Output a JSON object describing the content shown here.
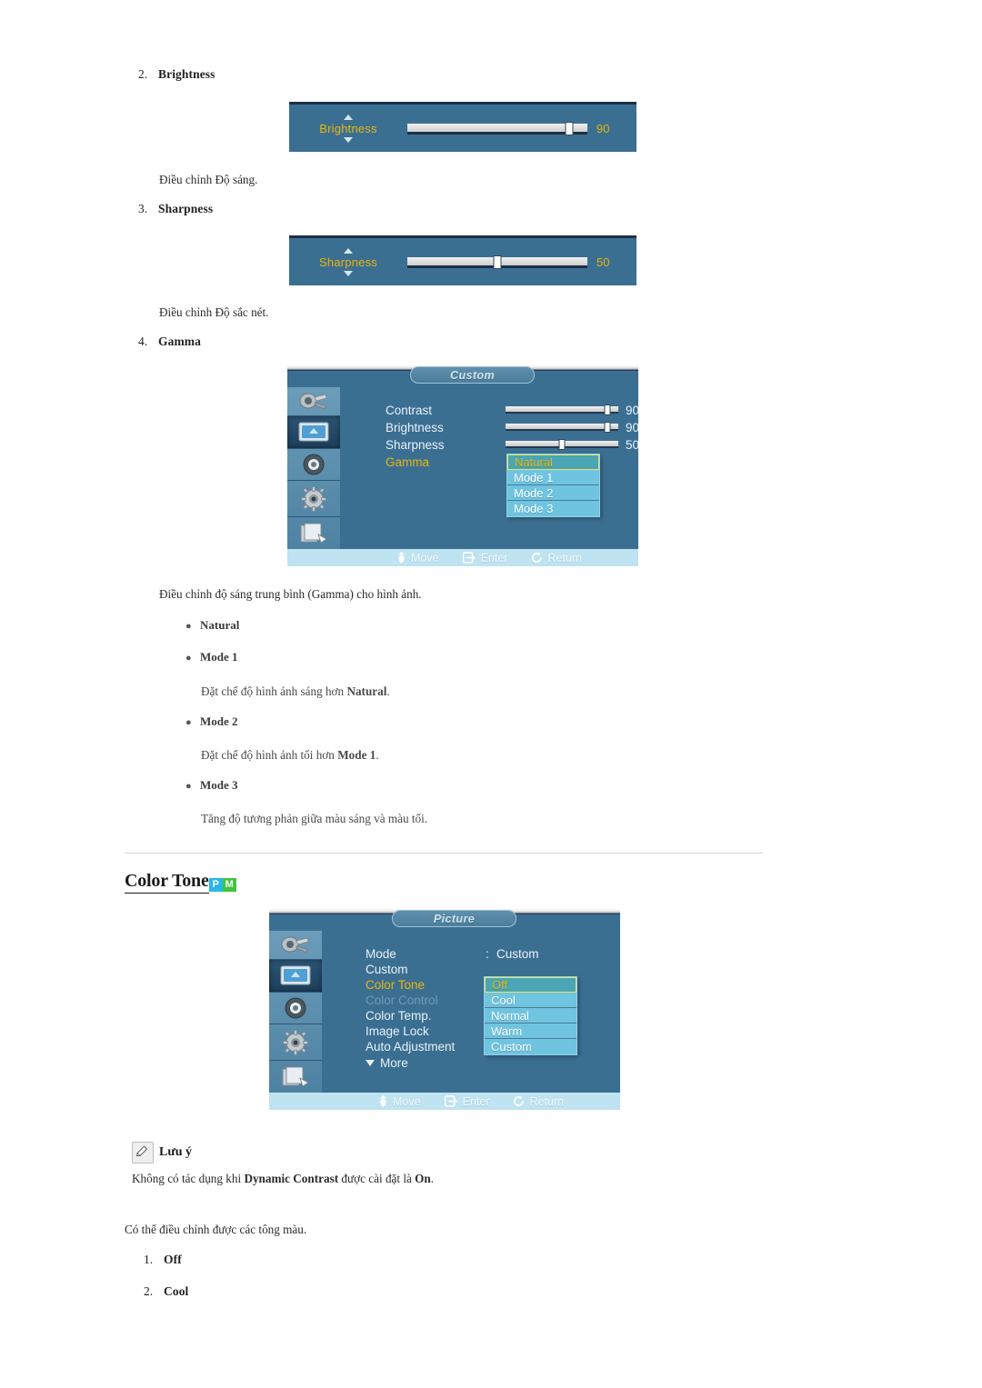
{
  "items": {
    "brightness": {
      "number": "2.",
      "label": "Brightness",
      "desc": "Điều chỉnh Độ sáng."
    },
    "sharpness": {
      "number": "3.",
      "label": "Sharpness",
      "desc": "Điều chỉnh Độ sắc nét."
    },
    "gamma": {
      "number": "4.",
      "label": "Gamma",
      "desc": "Điều chỉnh độ sáng trung bình (Gamma) cho hình ảnh."
    }
  },
  "brightness_widget": {
    "name": "Brightness",
    "value": "90",
    "percent": 90,
    "up_icon": "triangle-up-icon",
    "down_icon": "triangle-down-icon"
  },
  "sharpness_widget": {
    "name": "Sharpness",
    "value": "50",
    "percent": 50,
    "up_icon": "triangle-up-icon",
    "down_icon": "triangle-down-icon"
  },
  "custom_menu": {
    "title": "Custom",
    "sidebar": [
      {
        "icon": "input-source-icon",
        "selected": false
      },
      {
        "icon": "picture-icon",
        "selected": true
      },
      {
        "icon": "sound-speaker-icon",
        "selected": false
      },
      {
        "icon": "setup-gear-icon",
        "selected": false
      },
      {
        "icon": "multi-control-icon",
        "selected": false
      }
    ],
    "rows": [
      {
        "name": "Contrast",
        "value": "90",
        "percent": 90,
        "type": "slider",
        "state": "normal"
      },
      {
        "name": "Brightness",
        "value": "90",
        "percent": 90,
        "type": "slider",
        "state": "normal"
      },
      {
        "name": "Sharpness",
        "value": "50",
        "percent": 50,
        "type": "slider",
        "state": "normal"
      },
      {
        "name": "Gamma",
        "value": "",
        "type": "dropdown",
        "state": "active"
      }
    ],
    "dropdown": {
      "options": [
        "Natural",
        "Mode 1",
        "Mode 2",
        "Mode 3"
      ],
      "selected": "Natural"
    },
    "bottombar": [
      {
        "icon": "move-icon",
        "label": "Move"
      },
      {
        "icon": "enter-icon",
        "label": "Enter"
      },
      {
        "icon": "return-icon",
        "label": "Return"
      }
    ]
  },
  "gamma_modes": [
    {
      "label": "Natural",
      "desc": ""
    },
    {
      "label": "Mode 1",
      "desc": "Đặt chế độ hình ảnh sáng hơn ",
      "desc_bold": "Natural",
      "desc_tail": "."
    },
    {
      "label": "Mode 2",
      "desc": "Đặt chế độ hình ảnh tối hơn ",
      "desc_bold": "Mode 1",
      "desc_tail": "."
    },
    {
      "label": "Mode 3",
      "desc": "Tăng độ tương phản giữa màu sáng và màu tối.",
      "desc_bold": "",
      "desc_tail": ""
    }
  ],
  "color_tone_section": {
    "heading": "Color Tone",
    "badges": [
      {
        "letter": "P",
        "color": "#29b7e8"
      },
      {
        "letter": "M",
        "color": "#3fc63f"
      }
    ]
  },
  "picture_menu": {
    "title": "Picture",
    "sidebar": [
      {
        "icon": "input-source-icon",
        "selected": false
      },
      {
        "icon": "picture-icon",
        "selected": true
      },
      {
        "icon": "sound-speaker-icon",
        "selected": false
      },
      {
        "icon": "setup-gear-icon",
        "selected": false
      },
      {
        "icon": "multi-control-icon",
        "selected": false
      }
    ],
    "rows": [
      {
        "name": "Mode",
        "colon": ":",
        "value": "Custom",
        "state": "normal"
      },
      {
        "name": "Custom",
        "colon": "",
        "value": "",
        "state": "normal"
      },
      {
        "name": "Color Tone",
        "colon": ":",
        "value": "",
        "state": "active"
      },
      {
        "name": "Color Control",
        "colon": "",
        "value": "",
        "state": "disabled"
      },
      {
        "name": "Color Temp.",
        "colon": ":",
        "value": "",
        "state": "normal"
      },
      {
        "name": "Image Lock",
        "colon": ":",
        "value": "",
        "state": "normal"
      },
      {
        "name": "Auto Adjustment",
        "colon": ":",
        "value": "",
        "state": "normal"
      }
    ],
    "more_label": "More",
    "more_icon": "triangle-down-icon",
    "dropdown": {
      "options": [
        "Off",
        "Cool",
        "Normal",
        "Warm",
        "Custom"
      ],
      "selected": "Off"
    },
    "bottombar": [
      {
        "icon": "move-icon",
        "label": "Move"
      },
      {
        "icon": "enter-icon",
        "label": "Enter"
      },
      {
        "icon": "return-icon",
        "label": "Return"
      }
    ]
  },
  "note": {
    "icon": "note-pencil-icon",
    "title": "Lưu ý",
    "text_before": "Không có tác dụng khi ",
    "text_bold1": "Dynamic Contrast",
    "text_middle": " được cài đặt là ",
    "text_bold2": "On",
    "text_after": "."
  },
  "color_tone_body": {
    "intro": "Có thể điều chỉnh được các tông màu.",
    "options": [
      {
        "number": "1.",
        "label": "Off"
      },
      {
        "number": "2.",
        "label": "Cool"
      }
    ]
  }
}
